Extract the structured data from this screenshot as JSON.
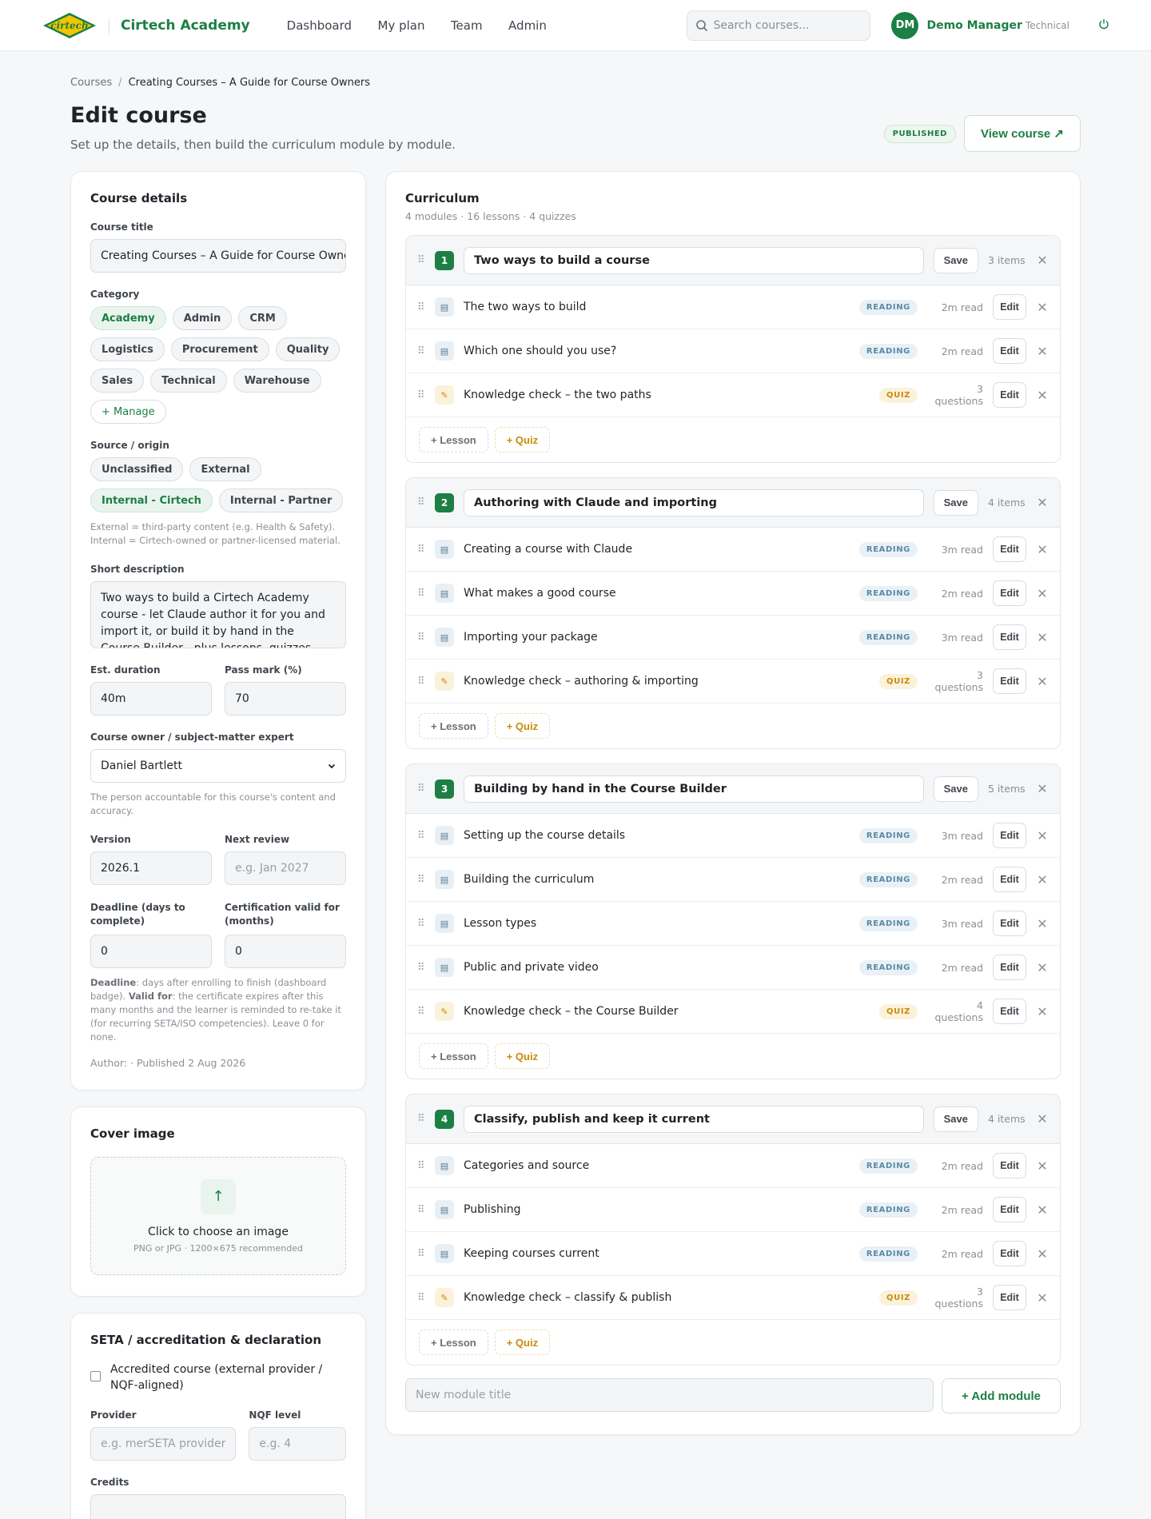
{
  "brand": {
    "logo_text": "cirtech",
    "name": "Cirtech Academy"
  },
  "nav": [
    "Dashboard",
    "My plan",
    "Team",
    "Admin"
  ],
  "search": {
    "placeholder": "Search courses..."
  },
  "user": {
    "initials": "DM",
    "name": "Demo Manager",
    "role": "Technical"
  },
  "breadcrumb": {
    "root": "Courses",
    "separator": "/",
    "current": "Creating Courses – A Guide for Course Owners"
  },
  "page": {
    "title": "Edit course",
    "subtitle": "Set up the details, then build the curriculum module by module.",
    "status_badge": "PUBLISHED",
    "view_button": "View course ↗"
  },
  "details": {
    "heading": "Course details",
    "title_label": "Course title",
    "title_value": "Creating Courses – A Guide for Course Owners",
    "category_label": "Category",
    "categories": [
      "Academy",
      "Admin",
      "CRM",
      "Logistics",
      "Procurement",
      "Quality",
      "Sales",
      "Technical",
      "Warehouse"
    ],
    "category_selected": "Academy",
    "manage_label": "+ Manage",
    "source_label": "Source / origin",
    "sources": [
      "Unclassified",
      "External",
      "Internal - Cirtech",
      "Internal - Partner"
    ],
    "source_selected": "Internal - Cirtech",
    "source_help": "External = third-party content (e.g. Health & Safety). Internal = Cirtech-owned or partner-licensed material.",
    "desc_label": "Short description",
    "desc_value": "Two ways to build a Cirtech Academy course - let Claude author it for you and import it, or build it by hand in the Course Builder - plus lessons, quizzes, video...",
    "duration_label": "Est. duration",
    "duration_value": "40m",
    "pass_label": "Pass mark (%)",
    "pass_value": "70",
    "owner_label": "Course owner / subject-matter expert",
    "owner_value": "Daniel Bartlett",
    "owner_help": "The person accountable for this course's content and accuracy.",
    "version_label": "Version",
    "version_value": "2026.1",
    "review_label": "Next review",
    "review_placeholder": "e.g. Jan 2027",
    "deadline_label": "Deadline (days to complete)",
    "deadline_value": "0",
    "cert_label": "Certification valid for (months)",
    "cert_value": "0",
    "help_deadline_term": "Deadline",
    "help_deadline_text": ": days after enrolling to finish (dashboard badge). ",
    "help_valid_term": "Valid for",
    "help_valid_text": ": the certificate expires after this many months and the learner is reminded to re-take it (for recurring SETA/ISO competencies). Leave 0 for none.",
    "author_line": "Author: · Published 2 Aug 2026"
  },
  "cover": {
    "heading": "Cover image",
    "upload_title": "Click to choose an image",
    "upload_sub": "PNG or JPG · 1200×675 recommended"
  },
  "seta": {
    "heading": "SETA / accreditation & declaration",
    "accredited_label": "Accredited course (external provider / NQF-aligned)",
    "provider_label": "Provider",
    "provider_placeholder": "e.g. merSETA provider",
    "nqf_label": "NQF level",
    "nqf_placeholder": "e.g. 4",
    "credits_label": "Credits"
  },
  "curriculum": {
    "heading": "Curriculum",
    "meta": "4 modules · 16 lessons · 4 quizzes",
    "save_label": "Save",
    "edit_label": "Edit",
    "add_lesson": "+ Lesson",
    "add_quiz": "+ Quiz",
    "modules": [
      {
        "num": "1",
        "title": "Two ways to build a course",
        "count": "3 items",
        "lessons": [
          {
            "title": "The two ways to build",
            "type": "READING",
            "dur": "2m read"
          },
          {
            "title": "Which one should you use?",
            "type": "READING",
            "dur": "2m read"
          },
          {
            "title": "Knowledge check – the two paths",
            "type": "QUIZ",
            "dur": "3 questions"
          }
        ]
      },
      {
        "num": "2",
        "title": "Authoring with Claude and importing",
        "count": "4 items",
        "lessons": [
          {
            "title": "Creating a course with Claude",
            "type": "READING",
            "dur": "3m read"
          },
          {
            "title": "What makes a good course",
            "type": "READING",
            "dur": "2m read"
          },
          {
            "title": "Importing your package",
            "type": "READING",
            "dur": "3m read"
          },
          {
            "title": "Knowledge check – authoring & importing",
            "type": "QUIZ",
            "dur": "3 questions"
          }
        ]
      },
      {
        "num": "3",
        "title": "Building by hand in the Course Builder",
        "count": "5 items",
        "lessons": [
          {
            "title": "Setting up the course details",
            "type": "READING",
            "dur": "3m read"
          },
          {
            "title": "Building the curriculum",
            "type": "READING",
            "dur": "2m read"
          },
          {
            "title": "Lesson types",
            "type": "READING",
            "dur": "3m read"
          },
          {
            "title": "Public and private video",
            "type": "READING",
            "dur": "2m read"
          },
          {
            "title": "Knowledge check – the Course Builder",
            "type": "QUIZ",
            "dur": "4 questions"
          }
        ]
      },
      {
        "num": "4",
        "title": "Classify, publish and keep it current",
        "count": "4 items",
        "lessons": [
          {
            "title": "Categories and source",
            "type": "READING",
            "dur": "2m read"
          },
          {
            "title": "Publishing",
            "type": "READING",
            "dur": "2m read"
          },
          {
            "title": "Keeping courses current",
            "type": "READING",
            "dur": "2m read"
          },
          {
            "title": "Knowledge check – classify & publish",
            "type": "QUIZ",
            "dur": "3 questions"
          }
        ]
      }
    ],
    "new_module_placeholder": "New module title",
    "add_module": "+ Add module"
  },
  "colors": {
    "brand_green": "#1c7f44",
    "quiz_amber": "#c98a0a",
    "reading_blue": "#5b8aa6"
  }
}
